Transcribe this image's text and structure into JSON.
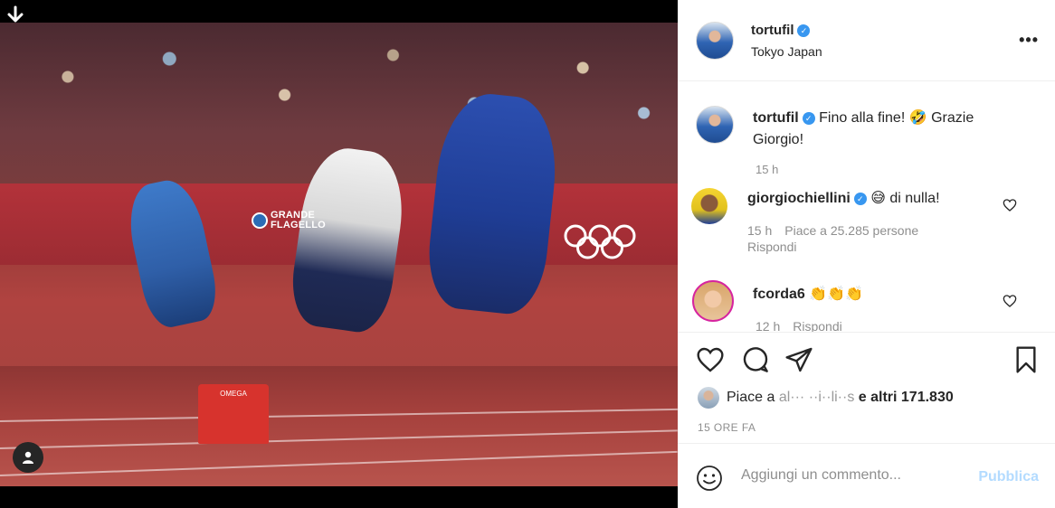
{
  "post": {
    "username": "tortufil",
    "location": "Tokyo Japan",
    "more_label": "•••"
  },
  "photo": {
    "overlay_text": "GRANDE FLAGELLO",
    "omega_label": "OMEGA"
  },
  "caption": {
    "username": "tortufil",
    "text": "Fino alla fine! 🤣 Grazie Giorgio!",
    "time": "15 h"
  },
  "comments": [
    {
      "username": "giorgiochiellini",
      "text": "😅 di nulla!",
      "time": "15 h",
      "likes": "Piace a 25.285 persone",
      "reply": "Rispondi"
    },
    {
      "username": "fcorda6",
      "text": "👏👏👏",
      "time": "12 h",
      "reply": "Rispondi"
    }
  ],
  "likes_summary": {
    "prefix": "Piace a ",
    "obscured_name": "al··· ··i··li··s",
    "suffix": " e altri 171.830"
  },
  "date": "15 ORE FA",
  "add_comment": {
    "placeholder": "Aggiungi un commento...",
    "publish_label": "Pubblica"
  },
  "colors": {
    "verified": "#3897f0",
    "publish": "#b3dbff",
    "text": "#262626",
    "meta": "#8e8e8e"
  }
}
